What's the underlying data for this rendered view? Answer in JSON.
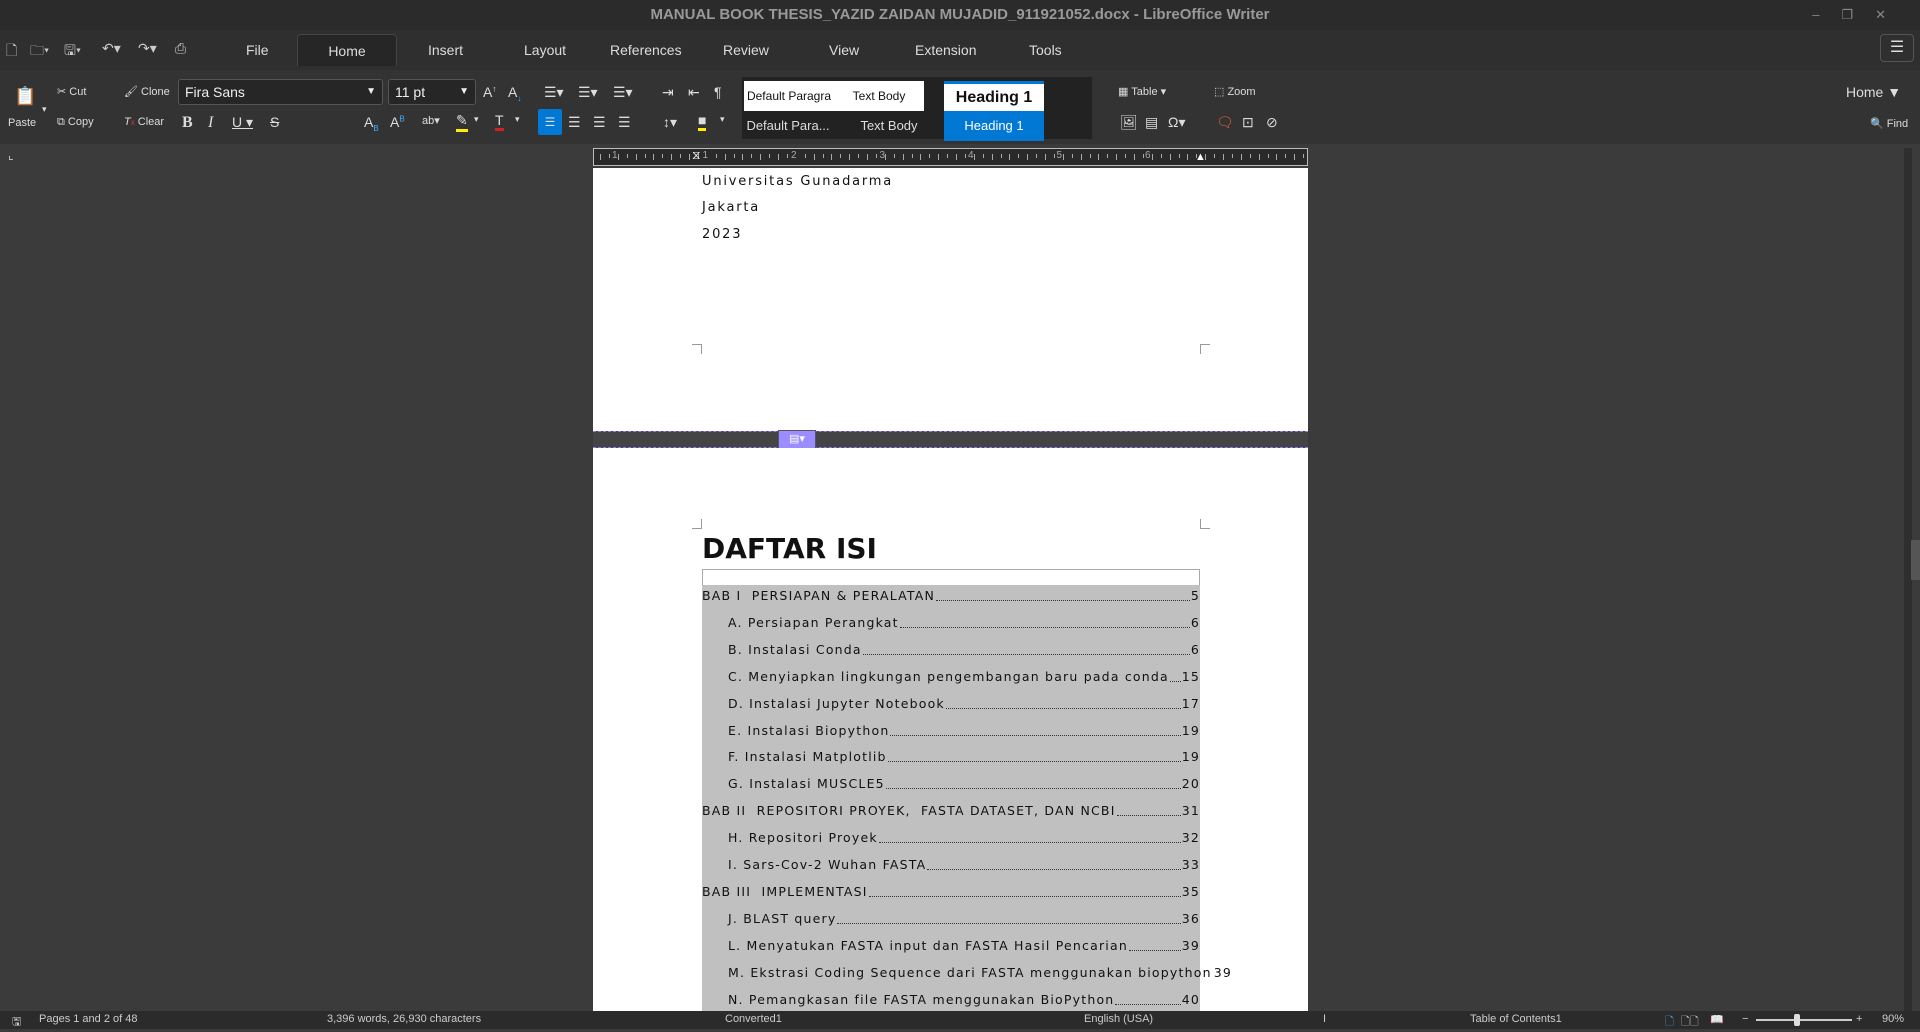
{
  "window": {
    "title": "MANUAL BOOK THESIS_YAZID ZAIDAN MUJADID_911921052.docx - LibreOffice Writer"
  },
  "menu": {
    "tabs": [
      "File",
      "Home",
      "Insert",
      "Layout",
      "References",
      "Review",
      "View",
      "Extension",
      "Tools"
    ],
    "active": "Home"
  },
  "toolbar": {
    "paste": "Paste",
    "cut": "Cut",
    "copy": "Copy",
    "clone": "Clone",
    "clear": "Clear",
    "font_name": "Fira Sans",
    "font_size": "11 pt",
    "table": "Table",
    "zoom": "Zoom",
    "find": "Find",
    "home_dropdown": "Home",
    "styles_preview": [
      "Default Paragra",
      "Text Body",
      "Heading 1"
    ],
    "styles_list": [
      "Default Para...",
      "Text Body",
      "Heading 1"
    ],
    "highlight_color": "#ffee00",
    "font_color": "#cc2222",
    "accent": "#0078d4"
  },
  "ruler": {
    "labels": [
      "1",
      "1",
      "2",
      "3",
      "4",
      "5",
      "6"
    ]
  },
  "document": {
    "page1_lines": [
      "Universitas Gunadarma",
      "Jakarta",
      "2023"
    ],
    "heading": "DAFTAR ISI",
    "toc": [
      {
        "level": 1,
        "text": "BAB I  PERSIAPAN & PERALATAN",
        "page": "5"
      },
      {
        "level": 2,
        "text": "A. Persiapan Perangkat",
        "page": "6"
      },
      {
        "level": 2,
        "text": "B. Instalasi Conda",
        "page": "6"
      },
      {
        "level": 2,
        "text": "C. Menyiapkan lingkungan pengembangan baru pada conda",
        "page": "15"
      },
      {
        "level": 2,
        "text": "D. Instalasi Jupyter Notebook",
        "page": "17"
      },
      {
        "level": 2,
        "text": "E. Instalasi Biopython",
        "page": "19"
      },
      {
        "level": 2,
        "text": "F. Instalasi Matplotlib",
        "page": "19"
      },
      {
        "level": 2,
        "text": "G. Instalasi MUSCLE5",
        "page": "20"
      },
      {
        "level": 1,
        "text": "BAB II  REPOSITORI PROYEK,  FASTA DATASET, DAN NCBI",
        "page": "31"
      },
      {
        "level": 2,
        "text": "H. Repositori Proyek",
        "page": "32"
      },
      {
        "level": 2,
        "text": "I. Sars-Cov-2 Wuhan FASTA",
        "page": "33"
      },
      {
        "level": 1,
        "text": "BAB III  IMPLEMENTASI",
        "page": "35"
      },
      {
        "level": 2,
        "text": "J. BLAST query",
        "page": "36"
      },
      {
        "level": 2,
        "text": "L. Menyatukan FASTA input dan FASTA Hasil Pencarian",
        "page": "39"
      },
      {
        "level": 2,
        "text": "M. Ekstrasi Coding Sequence dari FASTA menggunakan biopython",
        "page": "39"
      },
      {
        "level": 2,
        "text": "N. Pemangkasan file FASTA menggunakan BioPython",
        "page": "40"
      }
    ]
  },
  "status": {
    "pages": "Pages 1 and 2 of 48",
    "words": "3,396 words, 26,930 characters",
    "page_style": "Converted1",
    "language": "English (USA)",
    "section": "Table of Contents1",
    "zoom": "90%"
  }
}
